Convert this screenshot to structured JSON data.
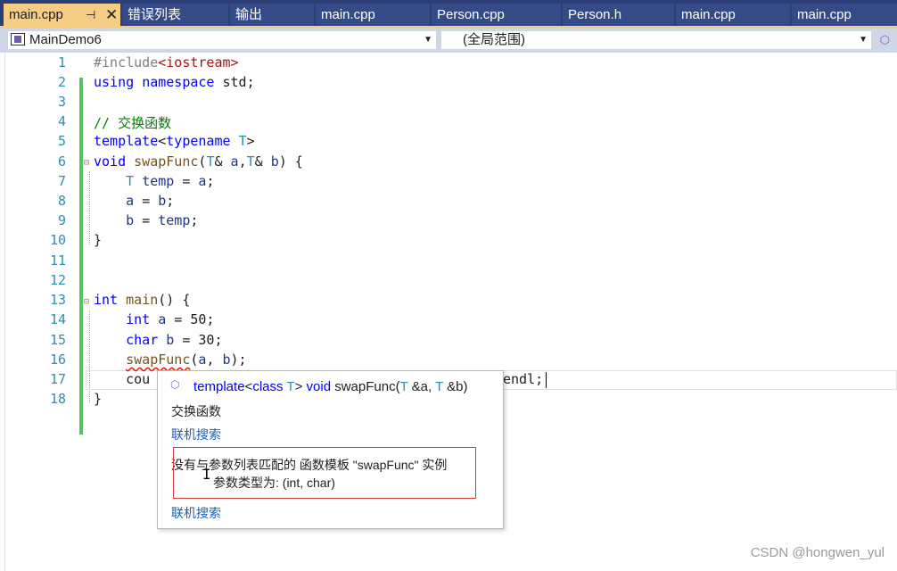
{
  "tabs": [
    {
      "label": "main.cpp"
    },
    {
      "label": "错误列表"
    },
    {
      "label": "输出"
    },
    {
      "label": "main.cpp"
    },
    {
      "label": "Person.cpp"
    },
    {
      "label": "Person.h"
    },
    {
      "label": "main.cpp"
    },
    {
      "label": "main.cpp"
    }
  ],
  "active_tab": {
    "pin": "⊣",
    "close": "✕"
  },
  "navbar": {
    "project": "MainDemo6",
    "scope": "(全局范围)"
  },
  "code": {
    "line_numbers": [
      "1",
      "2",
      "3",
      "4",
      "5",
      "6",
      "7",
      "8",
      "9",
      "10",
      "11",
      "12",
      "13",
      "14",
      "15",
      "16",
      "17",
      "18"
    ],
    "l1": {
      "a": "#include",
      "b": "<iostream>"
    },
    "l2": {
      "a": "using",
      "b": " ",
      "c": "namespace",
      "d": " std;"
    },
    "l4": "// 交换函数",
    "l5": {
      "a": "template",
      "b": "<",
      "c": "typename",
      "d": " ",
      "e": "T",
      "f": ">"
    },
    "l6": {
      "a": "void",
      "b": " ",
      "c": "swapFunc",
      "d": "(",
      "e": "T",
      "f": "& ",
      "g": "a",
      "h": ",",
      "i": "T",
      "j": "& ",
      "k": "b",
      "l": ") {"
    },
    "l7": {
      "a": "    ",
      "b": "T",
      "c": " ",
      "d": "temp",
      "e": " = ",
      "f": "a",
      "g": ";"
    },
    "l8": {
      "a": "    ",
      "b": "a",
      "c": " = ",
      "d": "b",
      "e": ";"
    },
    "l9": {
      "a": "    ",
      "b": "b",
      "c": " = ",
      "d": "temp",
      "e": ";"
    },
    "l10": "}",
    "l13": {
      "a": "int",
      "b": " ",
      "c": "main",
      "d": "() {"
    },
    "l14": {
      "a": "    ",
      "b": "int",
      "c": " ",
      "d": "a",
      "e": " = 50;"
    },
    "l15": {
      "a": "    ",
      "b": "char",
      "c": " ",
      "d": "b",
      "e": " = 30;"
    },
    "l16": {
      "a": "    ",
      "b": "swapFunc",
      "c": "(",
      "d": "a",
      "e": ", ",
      "f": "b",
      "g": ");"
    },
    "l17": {
      "a": "    ",
      "b": "cou",
      "c": "endl;"
    },
    "l18": "}"
  },
  "tooltip": {
    "sig": {
      "a": "template",
      "b": "<",
      "c": "class",
      "d": " ",
      "e": "T",
      "f": "> ",
      "g": "void",
      "h": " swapFunc(",
      "i": "T",
      "j": " &a, ",
      "k": "T",
      "l": " &b)"
    },
    "description": "交换函数",
    "link1": "联机搜索",
    "error_line1": "没有与参数列表匹配的 函数模板 \"swapFunc\" 实例",
    "error_line2": "参数类型为:  (int, char)",
    "link2": "联机搜索"
  },
  "watermark": "CSDN @hongwen_yul",
  "colors": {
    "tab_bar": "#2b3e75",
    "active_tab": "#f5cc84",
    "keyword": "#0000ff",
    "type_param": "#2b91af",
    "comment": "#008000",
    "string": "#a31515",
    "change_bar": "#58c25f",
    "error_box": "#d93a3a"
  }
}
